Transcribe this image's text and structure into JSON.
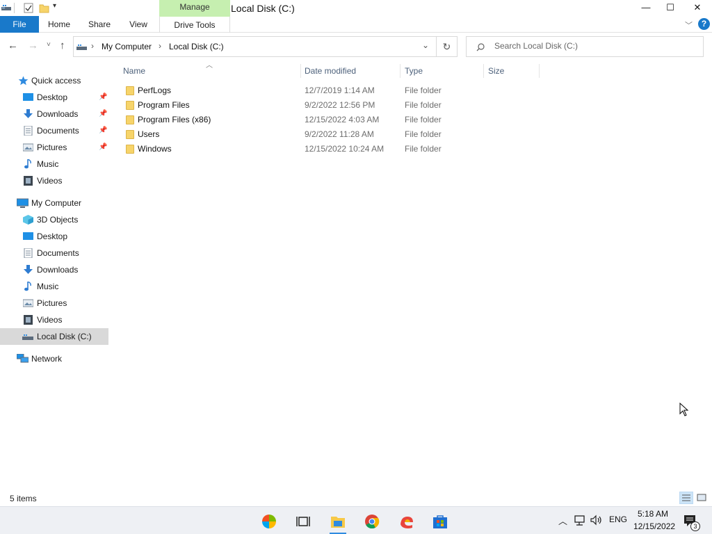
{
  "window": {
    "title": "Local Disk (C:)",
    "context_tab": "Manage",
    "controls": {
      "minimize": "—",
      "maximize": "☐",
      "close": "✕"
    }
  },
  "ribbon": {
    "tabs": [
      {
        "label": "File"
      },
      {
        "label": "Home"
      },
      {
        "label": "Share"
      },
      {
        "label": "View"
      },
      {
        "label": "Drive Tools"
      }
    ],
    "help": "?"
  },
  "address": {
    "breadcrumb": [
      "My Computer",
      "Local Disk (C:)"
    ],
    "separator": "›"
  },
  "search": {
    "placeholder": "Search Local Disk (C:)"
  },
  "nav_pane": {
    "quick_access": {
      "label": "Quick access",
      "items": [
        {
          "label": "Desktop",
          "icon": "desktop-icon",
          "pinned": true
        },
        {
          "label": "Downloads",
          "icon": "downloads-icon",
          "pinned": true
        },
        {
          "label": "Documents",
          "icon": "documents-icon",
          "pinned": true
        },
        {
          "label": "Pictures",
          "icon": "pictures-icon",
          "pinned": true
        },
        {
          "label": "Music",
          "icon": "music-icon",
          "pinned": false
        },
        {
          "label": "Videos",
          "icon": "videos-icon",
          "pinned": false
        }
      ]
    },
    "my_computer": {
      "label": "My Computer",
      "items": [
        {
          "label": "3D Objects",
          "icon": "3d-objects-icon"
        },
        {
          "label": "Desktop",
          "icon": "desktop-icon"
        },
        {
          "label": "Documents",
          "icon": "documents-icon"
        },
        {
          "label": "Downloads",
          "icon": "downloads-icon"
        },
        {
          "label": "Music",
          "icon": "music-icon"
        },
        {
          "label": "Pictures",
          "icon": "pictures-icon"
        },
        {
          "label": "Videos",
          "icon": "videos-icon"
        },
        {
          "label": "Local Disk (C:)",
          "icon": "drive-icon",
          "selected": true
        }
      ]
    },
    "network": {
      "label": "Network"
    }
  },
  "file_list": {
    "columns": [
      "Name",
      "Date modified",
      "Type",
      "Size"
    ],
    "rows": [
      {
        "name": "PerfLogs",
        "date": "12/7/2019 1:14 AM",
        "type": "File folder",
        "size": ""
      },
      {
        "name": "Program Files",
        "date": "9/2/2022 12:56 PM",
        "type": "File folder",
        "size": ""
      },
      {
        "name": "Program Files (x86)",
        "date": "12/15/2022 4:03 AM",
        "type": "File folder",
        "size": ""
      },
      {
        "name": "Users",
        "date": "9/2/2022 11:28 AM",
        "type": "File folder",
        "size": ""
      },
      {
        "name": "Windows",
        "date": "12/15/2022 10:24 AM",
        "type": "File folder",
        "size": ""
      }
    ]
  },
  "status": {
    "item_count": "5 items"
  },
  "taskbar": {
    "apps": [
      "start-icon",
      "task-view-icon",
      "file-explorer-icon",
      "chrome-icon",
      "edge-icon",
      "store-icon"
    ],
    "tray": {
      "language": "ENG",
      "time": "5:18 AM",
      "date": "12/15/2022",
      "notification_count": "3"
    }
  },
  "colors": {
    "accent": "#1979ca",
    "manage_tab": "#c6efb0",
    "selected_nav": "#d9d9d9",
    "folder": "#f7d46a",
    "header_text": "#4c607a"
  }
}
